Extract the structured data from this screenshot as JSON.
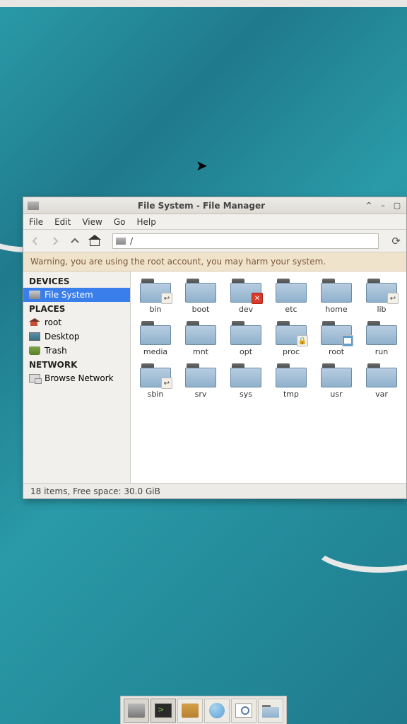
{
  "window": {
    "title": "File System - File Manager",
    "menus": [
      "File",
      "Edit",
      "View",
      "Go",
      "Help"
    ],
    "path": "/",
    "warning": "Warning, you are using the root account, you may harm your system.",
    "status": "18 items, Free space: 30.0 GiB"
  },
  "sidebar": {
    "sections": [
      {
        "title": "DEVICES",
        "items": [
          {
            "label": "File System",
            "icon": "disk",
            "selected": true
          }
        ]
      },
      {
        "title": "PLACES",
        "items": [
          {
            "label": "root",
            "icon": "home"
          },
          {
            "label": "Desktop",
            "icon": "desk"
          },
          {
            "label": "Trash",
            "icon": "trash"
          }
        ]
      },
      {
        "title": "NETWORK",
        "items": [
          {
            "label": "Browse Network",
            "icon": "net"
          }
        ]
      }
    ]
  },
  "folders": [
    {
      "name": "bin",
      "badge": "link"
    },
    {
      "name": "boot"
    },
    {
      "name": "dev",
      "badge": "error"
    },
    {
      "name": "etc"
    },
    {
      "name": "home"
    },
    {
      "name": "lib",
      "badge": "link"
    },
    {
      "name": "media"
    },
    {
      "name": "mnt"
    },
    {
      "name": "opt"
    },
    {
      "name": "proc",
      "badge": "lock"
    },
    {
      "name": "root",
      "badge": "home"
    },
    {
      "name": "run"
    },
    {
      "name": "sbin",
      "badge": "link"
    },
    {
      "name": "srv"
    },
    {
      "name": "sys"
    },
    {
      "name": "tmp"
    },
    {
      "name": "usr"
    },
    {
      "name": "var"
    }
  ],
  "taskbar": [
    {
      "name": "file-manager",
      "icon": "disk",
      "active": true
    },
    {
      "name": "terminal",
      "icon": "term",
      "active": true
    },
    {
      "name": "files",
      "icon": "files"
    },
    {
      "name": "web-browser",
      "icon": "globe"
    },
    {
      "name": "search",
      "icon": "search"
    },
    {
      "name": "folder",
      "icon": "fold"
    }
  ]
}
